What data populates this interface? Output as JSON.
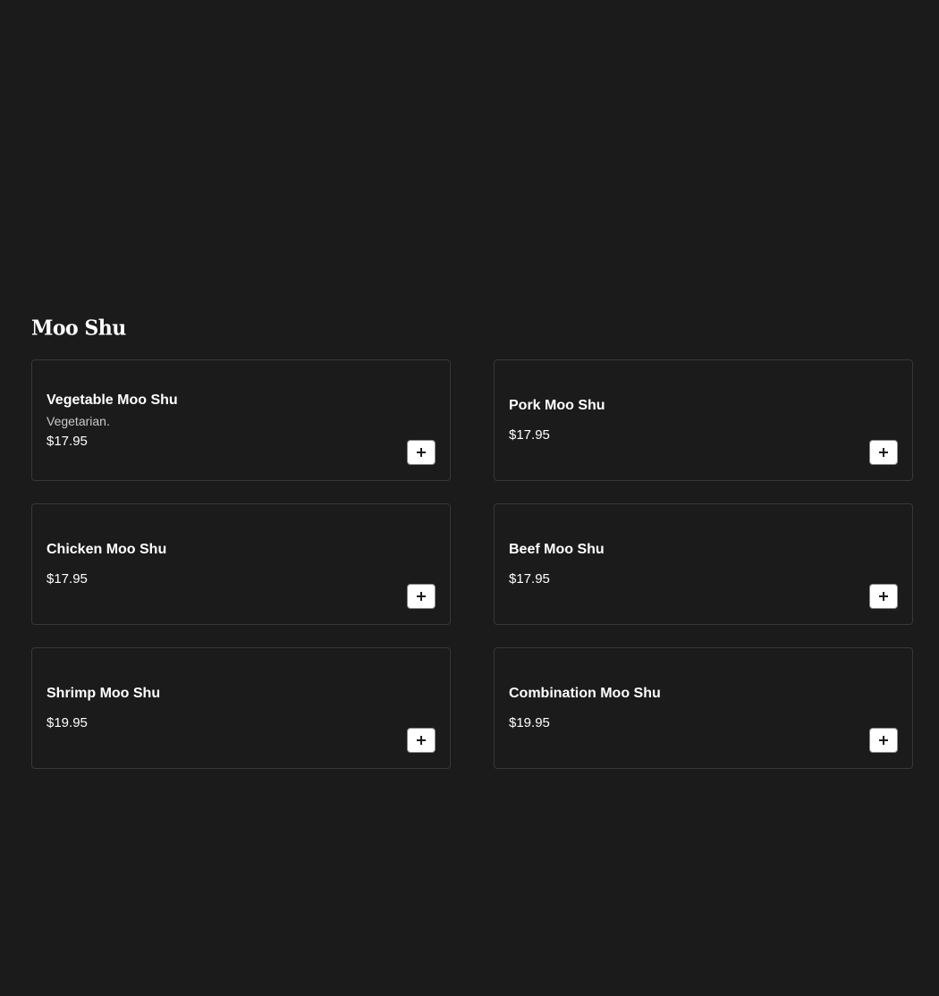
{
  "section": {
    "title": "Moo Shu"
  },
  "items": [
    {
      "name": "Vegetable Moo Shu",
      "description": "Vegetarian.",
      "price": "$17.95"
    },
    {
      "name": "Pork Moo Shu",
      "description": "",
      "price": "$17.95"
    },
    {
      "name": "Chicken Moo Shu",
      "description": "",
      "price": "$17.95"
    },
    {
      "name": "Beef Moo Shu",
      "description": "",
      "price": "$17.95"
    },
    {
      "name": "Shrimp Moo Shu",
      "description": "",
      "price": "$19.95"
    },
    {
      "name": "Combination Moo Shu",
      "description": "",
      "price": "$19.95"
    }
  ],
  "icons": {
    "add": "plus-icon"
  },
  "colors": {
    "background": "#1b1b1b",
    "card_border": "#383838",
    "text": "#ffffff",
    "muted_text": "#c9c9c9",
    "button_bg": "#ffffff"
  }
}
